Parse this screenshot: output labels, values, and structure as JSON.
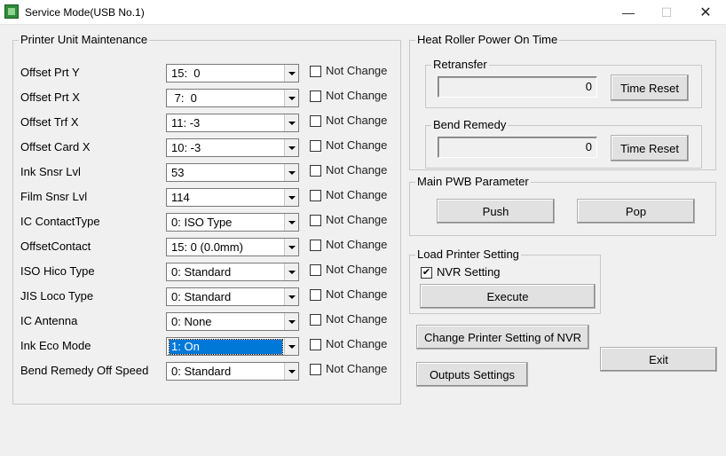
{
  "window": {
    "title": "Service Mode(USB No.1)",
    "min_glyph": "—",
    "max_glyph": "☐",
    "close_glyph": "✕"
  },
  "printer_unit": {
    "group_label": "Printer Unit Maintenance",
    "not_change_label": "Not Change",
    "rows": [
      {
        "label": "Offset Prt Y",
        "value": "15:  0"
      },
      {
        "label": "Offset Prt X",
        "value": " 7:  0"
      },
      {
        "label": "Offset Trf X",
        "value": "11: -3"
      },
      {
        "label": "Offset Card X",
        "value": "10: -3"
      },
      {
        "label": "Ink Snsr Lvl",
        "value": "53"
      },
      {
        "label": "Film Snsr Lvl",
        "value": "114"
      },
      {
        "label": "IC ContactType",
        "value": "0: ISO Type"
      },
      {
        "label": "OffsetContact",
        "value": "15: 0 (0.0mm)"
      },
      {
        "label": "ISO Hico Type",
        "value": "0: Standard"
      },
      {
        "label": "JIS Loco Type",
        "value": "0: Standard"
      },
      {
        "label": "IC Antenna",
        "value": "0: None"
      },
      {
        "label": "Ink Eco Mode",
        "value": "1: On"
      },
      {
        "label": "Bend Remedy Off Speed",
        "value": "0: Standard"
      }
    ]
  },
  "heat_roller": {
    "group_label": "Heat Roller Power On Time",
    "retransfer": {
      "label": "Retransfer",
      "value": "0",
      "reset_label": "Time Reset"
    },
    "bend_remedy": {
      "label": "Bend Remedy",
      "value": "0",
      "reset_label": "Time Reset"
    }
  },
  "main_pwb": {
    "group_label": "Main PWB Parameter",
    "push_label": "Push",
    "pop_label": "Pop"
  },
  "load_printer": {
    "group_label": "Load Printer Setting",
    "nvr_label": "NVR Setting",
    "nvr_checked_glyph": "✔",
    "execute_label": "Execute"
  },
  "actions": {
    "change_nvr_label": "Change Printer Setting of NVR",
    "outputs_label": "Outputs Settings",
    "exit_label": "Exit"
  }
}
